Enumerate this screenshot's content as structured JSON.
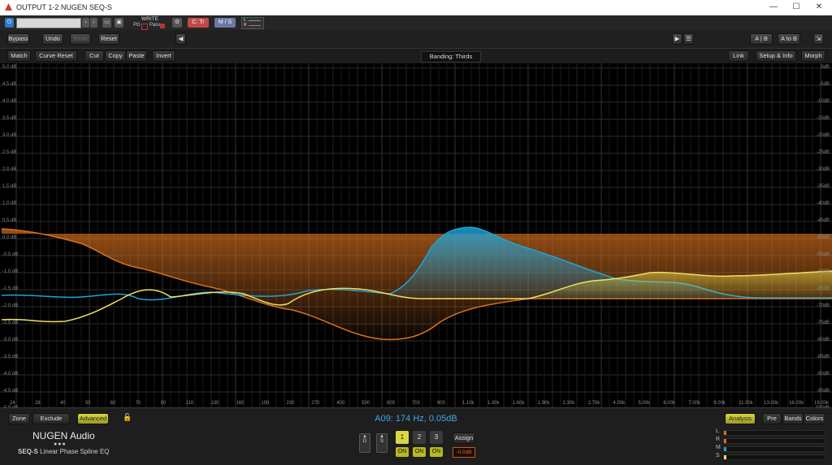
{
  "window": {
    "title": "OUTPUT 1-2 NUGEN SEQ-S",
    "minimize": "—",
    "maximize": "☐",
    "close": "✕"
  },
  "host": {
    "write_label": "WRITE",
    "pg_label": "PG",
    "pass_label": "Pass",
    "ctr_label": "C: Tr",
    "ms_label": "M / S",
    "l_label": "L",
    "r_label": "R"
  },
  "toolbar": {
    "bypass": "Bypass",
    "undo": "Undo",
    "redo": "Redo",
    "reset": "Reset",
    "ab": "A | B",
    "atob": "A to B"
  },
  "toolbar2": {
    "match": "Match",
    "curve_reset": "Curve Reset",
    "cut": "Cut",
    "copy": "Copy",
    "paste": "Paste",
    "invert": "Invert",
    "banding": "Banding: Thirds",
    "link": "Link",
    "setup": "Setup & Info",
    "morph": "Morph"
  },
  "graph": {
    "y_left": [
      "5.0 dB",
      "4.5 dB",
      "4.0 dB",
      "3.5 dB",
      "3.0 dB",
      "2.5 dB",
      "2.0 dB",
      "1.5 dB",
      "1.0 dB",
      "0.5 dB",
      "0.0 dB",
      "-0.5 dB",
      "-1.0 dB",
      "-1.5 dB",
      "-2.0 dB",
      "-2.5 dB",
      "-3.0 dB",
      "-3.5 dB",
      "-4.0 dB",
      "-4.5 dB",
      "-5.0 dB"
    ],
    "y_right": [
      "0dB",
      "-5dB",
      "-10dB",
      "-15dB",
      "-20dB",
      "-25dB",
      "-30dB",
      "-35dB",
      "-40dB",
      "-45dB",
      "-50dB",
      "-55dB",
      "-60dB",
      "-65dB",
      "-70dB",
      "-75dB",
      "-80dB",
      "-85dB",
      "-90dB",
      "-95dB",
      "-100dB"
    ],
    "x_labels": [
      "24",
      "28",
      "40",
      "50",
      "60",
      "70",
      "90",
      "110",
      "130",
      "160",
      "190",
      "230",
      "270",
      "400",
      "500",
      "600",
      "700",
      "900",
      "1.10k",
      "1.30k",
      "1.60k",
      "1.90k",
      "2.30k",
      "2.70k",
      "4.00k",
      "5.00k",
      "6.00k",
      "7.00k",
      "9.00k",
      "11.00k",
      "13.00k",
      "16.00k",
      "19.00k"
    ],
    "colors": {
      "orange": "#d8701e",
      "blue": "#1fa3d8",
      "yellow": "#f0e060"
    }
  },
  "bottom": {
    "zone": "Zone",
    "exclude": "Exclude",
    "advanced": "Advanced",
    "readout": "A09: 174 Hz, 0.05dB",
    "brand": "NUGEN Audio",
    "product": "SEQ-S",
    "product_sub": "Linear Phase Spline EQ",
    "d_label": "D",
    "s_label": "S",
    "slots": [
      "1",
      "2",
      "3"
    ],
    "on_label": "ON",
    "assign": "Assign",
    "gain": "-0.0dB",
    "analysis": "Analysis",
    "pre": "Pre",
    "bands": "Bands",
    "colors": "Colors",
    "meters": [
      {
        "label": "L",
        "color": "#d8701e",
        "level": 0.02
      },
      {
        "label": "R",
        "color": "#d8701e",
        "level": 0.02
      },
      {
        "label": "M",
        "color": "#1fa3d8",
        "level": 0.02
      },
      {
        "label": "S",
        "color": "#f0e060",
        "level": 0.02
      }
    ]
  }
}
